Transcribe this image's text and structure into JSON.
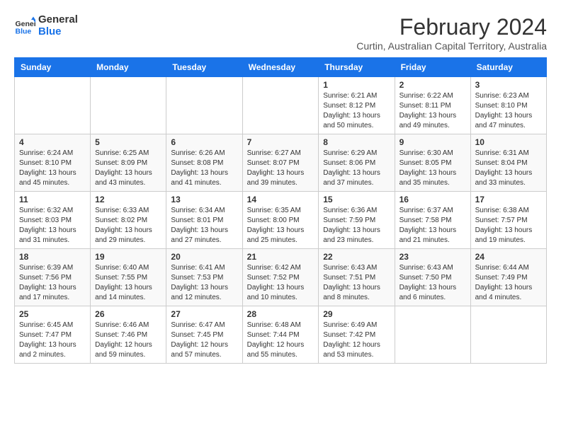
{
  "logo": {
    "line1": "General",
    "line2": "Blue"
  },
  "header": {
    "title": "February 2024",
    "subtitle": "Curtin, Australian Capital Territory, Australia"
  },
  "days_of_week": [
    "Sunday",
    "Monday",
    "Tuesday",
    "Wednesday",
    "Thursday",
    "Friday",
    "Saturday"
  ],
  "weeks": [
    [
      {
        "day": "",
        "info": ""
      },
      {
        "day": "",
        "info": ""
      },
      {
        "day": "",
        "info": ""
      },
      {
        "day": "",
        "info": ""
      },
      {
        "day": "1",
        "info": "Sunrise: 6:21 AM\nSunset: 8:12 PM\nDaylight: 13 hours\nand 50 minutes."
      },
      {
        "day": "2",
        "info": "Sunrise: 6:22 AM\nSunset: 8:11 PM\nDaylight: 13 hours\nand 49 minutes."
      },
      {
        "day": "3",
        "info": "Sunrise: 6:23 AM\nSunset: 8:10 PM\nDaylight: 13 hours\nand 47 minutes."
      }
    ],
    [
      {
        "day": "4",
        "info": "Sunrise: 6:24 AM\nSunset: 8:10 PM\nDaylight: 13 hours\nand 45 minutes."
      },
      {
        "day": "5",
        "info": "Sunrise: 6:25 AM\nSunset: 8:09 PM\nDaylight: 13 hours\nand 43 minutes."
      },
      {
        "day": "6",
        "info": "Sunrise: 6:26 AM\nSunset: 8:08 PM\nDaylight: 13 hours\nand 41 minutes."
      },
      {
        "day": "7",
        "info": "Sunrise: 6:27 AM\nSunset: 8:07 PM\nDaylight: 13 hours\nand 39 minutes."
      },
      {
        "day": "8",
        "info": "Sunrise: 6:29 AM\nSunset: 8:06 PM\nDaylight: 13 hours\nand 37 minutes."
      },
      {
        "day": "9",
        "info": "Sunrise: 6:30 AM\nSunset: 8:05 PM\nDaylight: 13 hours\nand 35 minutes."
      },
      {
        "day": "10",
        "info": "Sunrise: 6:31 AM\nSunset: 8:04 PM\nDaylight: 13 hours\nand 33 minutes."
      }
    ],
    [
      {
        "day": "11",
        "info": "Sunrise: 6:32 AM\nSunset: 8:03 PM\nDaylight: 13 hours\nand 31 minutes."
      },
      {
        "day": "12",
        "info": "Sunrise: 6:33 AM\nSunset: 8:02 PM\nDaylight: 13 hours\nand 29 minutes."
      },
      {
        "day": "13",
        "info": "Sunrise: 6:34 AM\nSunset: 8:01 PM\nDaylight: 13 hours\nand 27 minutes."
      },
      {
        "day": "14",
        "info": "Sunrise: 6:35 AM\nSunset: 8:00 PM\nDaylight: 13 hours\nand 25 minutes."
      },
      {
        "day": "15",
        "info": "Sunrise: 6:36 AM\nSunset: 7:59 PM\nDaylight: 13 hours\nand 23 minutes."
      },
      {
        "day": "16",
        "info": "Sunrise: 6:37 AM\nSunset: 7:58 PM\nDaylight: 13 hours\nand 21 minutes."
      },
      {
        "day": "17",
        "info": "Sunrise: 6:38 AM\nSunset: 7:57 PM\nDaylight: 13 hours\nand 19 minutes."
      }
    ],
    [
      {
        "day": "18",
        "info": "Sunrise: 6:39 AM\nSunset: 7:56 PM\nDaylight: 13 hours\nand 17 minutes."
      },
      {
        "day": "19",
        "info": "Sunrise: 6:40 AM\nSunset: 7:55 PM\nDaylight: 13 hours\nand 14 minutes."
      },
      {
        "day": "20",
        "info": "Sunrise: 6:41 AM\nSunset: 7:53 PM\nDaylight: 13 hours\nand 12 minutes."
      },
      {
        "day": "21",
        "info": "Sunrise: 6:42 AM\nSunset: 7:52 PM\nDaylight: 13 hours\nand 10 minutes."
      },
      {
        "day": "22",
        "info": "Sunrise: 6:43 AM\nSunset: 7:51 PM\nDaylight: 13 hours\nand 8 minutes."
      },
      {
        "day": "23",
        "info": "Sunrise: 6:43 AM\nSunset: 7:50 PM\nDaylight: 13 hours\nand 6 minutes."
      },
      {
        "day": "24",
        "info": "Sunrise: 6:44 AM\nSunset: 7:49 PM\nDaylight: 13 hours\nand 4 minutes."
      }
    ],
    [
      {
        "day": "25",
        "info": "Sunrise: 6:45 AM\nSunset: 7:47 PM\nDaylight: 13 hours\nand 2 minutes."
      },
      {
        "day": "26",
        "info": "Sunrise: 6:46 AM\nSunset: 7:46 PM\nDaylight: 12 hours\nand 59 minutes."
      },
      {
        "day": "27",
        "info": "Sunrise: 6:47 AM\nSunset: 7:45 PM\nDaylight: 12 hours\nand 57 minutes."
      },
      {
        "day": "28",
        "info": "Sunrise: 6:48 AM\nSunset: 7:44 PM\nDaylight: 12 hours\nand 55 minutes."
      },
      {
        "day": "29",
        "info": "Sunrise: 6:49 AM\nSunset: 7:42 PM\nDaylight: 12 hours\nand 53 minutes."
      },
      {
        "day": "",
        "info": ""
      },
      {
        "day": "",
        "info": ""
      }
    ]
  ]
}
